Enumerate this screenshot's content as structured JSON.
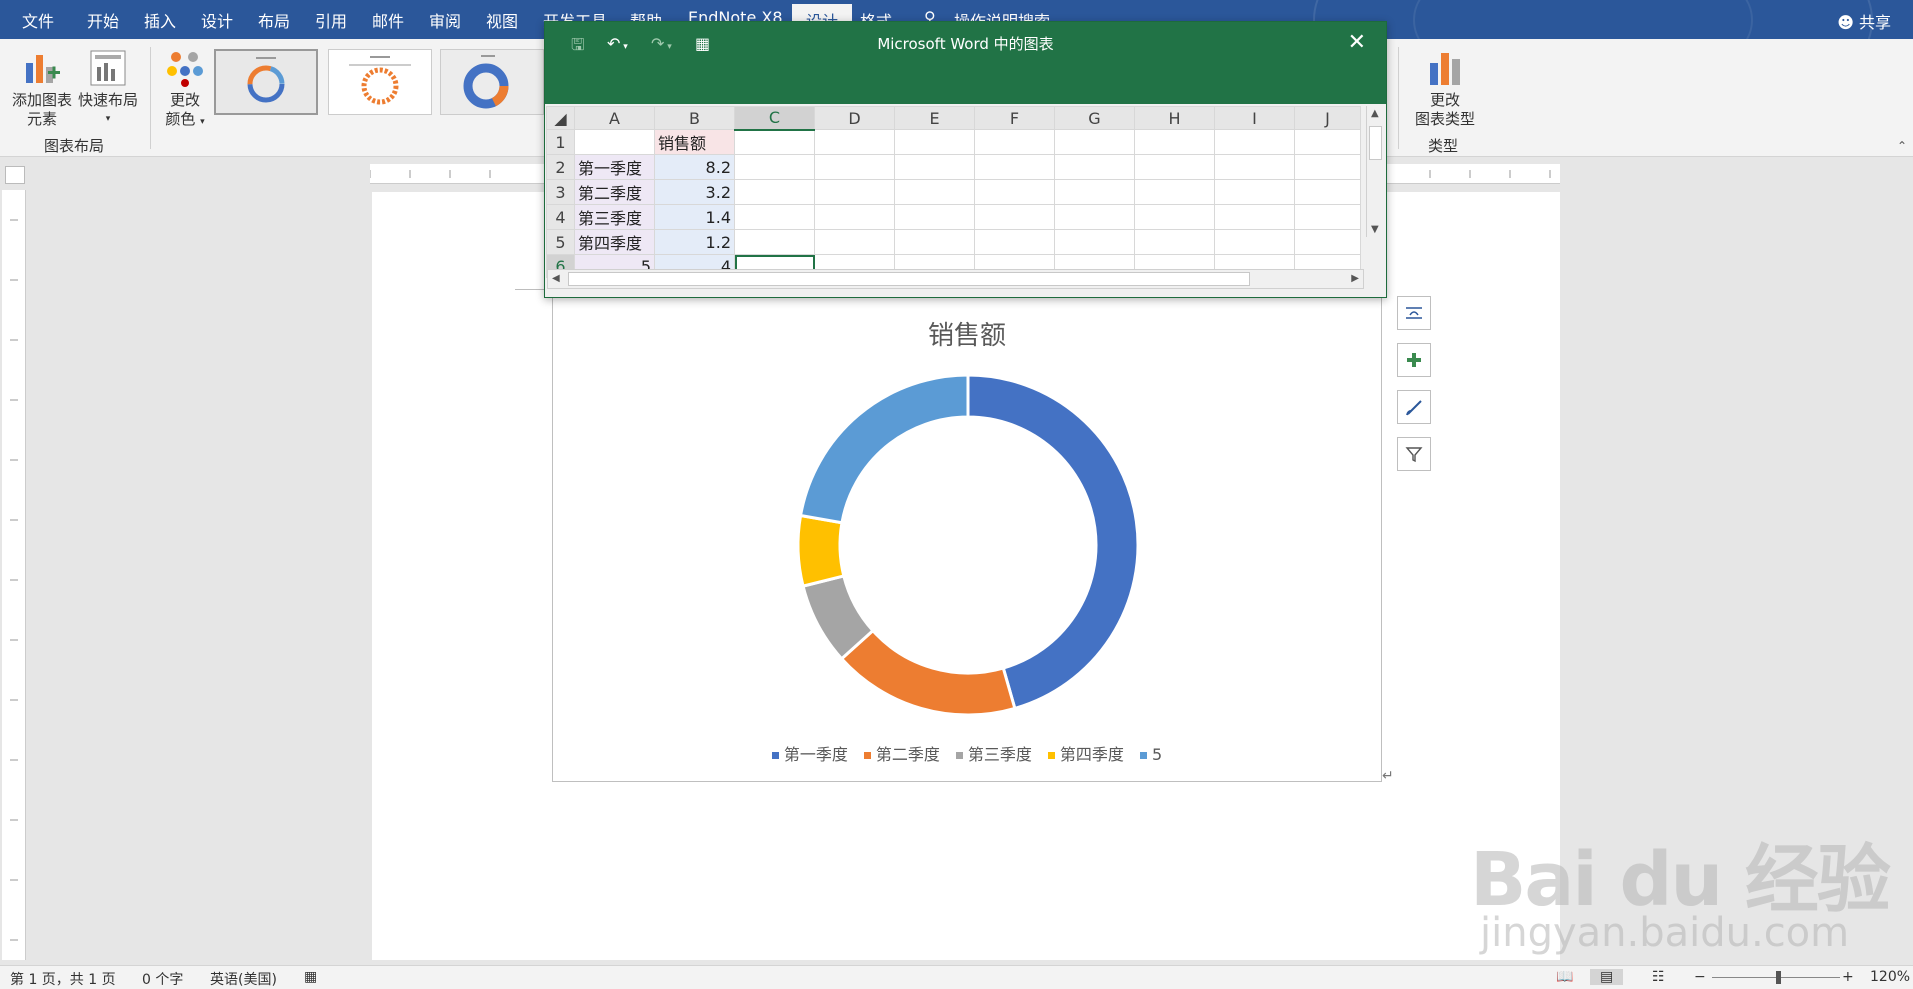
{
  "menubar": {
    "items": [
      "文件",
      "开始",
      "插入",
      "设计",
      "布局",
      "引用",
      "邮件",
      "审阅",
      "视图",
      "开发工具",
      "帮助",
      "EndNote X8",
      "设计",
      "格式"
    ],
    "search": "操作说明搜索",
    "share": "共享"
  },
  "ribbon": {
    "add_element": "添加图表\n元素",
    "add_element_line1": "添加图表",
    "add_element_line2": "元素",
    "quick_layout": "快速布局",
    "change_color_line1": "更改",
    "change_color_line2": "颜色",
    "group_chart_layout": "图表布局",
    "change_type_line1": "更改",
    "change_type_line2": "图表类型",
    "group_type": "类型"
  },
  "excel": {
    "title": "Microsoft Word 中的图表",
    "columns": [
      "A",
      "B",
      "C",
      "D",
      "E",
      "F",
      "G",
      "H",
      "I",
      "J"
    ],
    "rows": [
      {
        "num": "1",
        "a": "",
        "b": "销售额"
      },
      {
        "num": "2",
        "a": "第一季度",
        "b": "8.2"
      },
      {
        "num": "3",
        "a": "第二季度",
        "b": "3.2"
      },
      {
        "num": "4",
        "a": "第三季度",
        "b": "1.4"
      },
      {
        "num": "5",
        "a": "第四季度",
        "b": "1.2"
      },
      {
        "num": "6",
        "a": "5",
        "b": "4"
      }
    ]
  },
  "chart_data": {
    "type": "pie",
    "variant": "doughnut",
    "title": "销售额",
    "categories": [
      "第一季度",
      "第二季度",
      "第三季度",
      "第四季度",
      "5"
    ],
    "values": [
      8.2,
      3.2,
      1.4,
      1.2,
      4
    ],
    "colors": [
      "#4472c4",
      "#ed7d31",
      "#a5a5a5",
      "#ffc000",
      "#5b9bd5"
    ],
    "legend": "bottom"
  },
  "status": {
    "page": "第 1 页，共 1 页",
    "words": "0 个字",
    "lang": "英语(美国)",
    "zoom": "120%"
  },
  "watermark": {
    "brand": "Bai du 经验",
    "url": "jingyan.baidu.com"
  }
}
